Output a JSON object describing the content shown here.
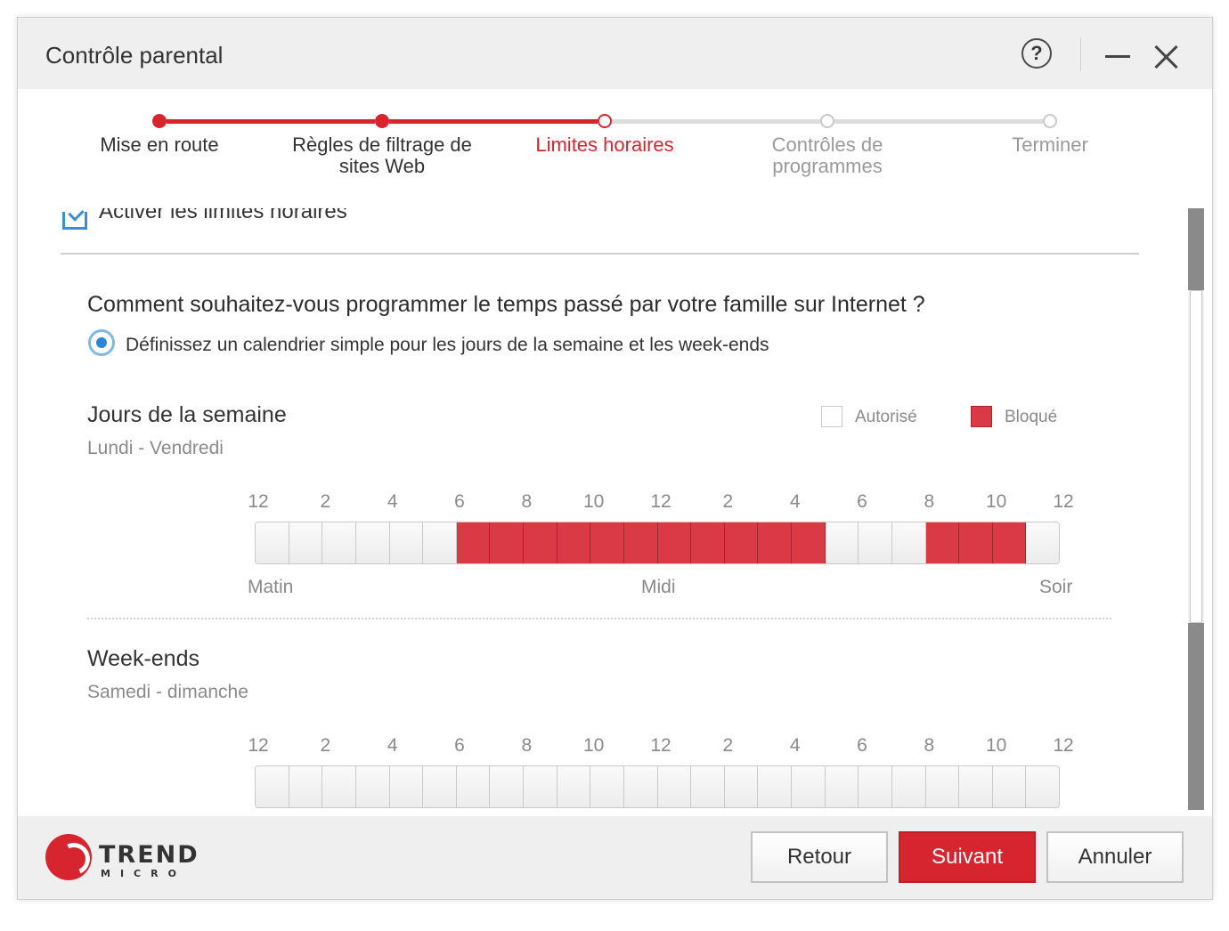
{
  "window": {
    "title": "Contrôle parental"
  },
  "stepper": {
    "steps": [
      {
        "label": "Mise en route",
        "state": "done"
      },
      {
        "label": "Règles de filtrage de sites Web",
        "state": "done"
      },
      {
        "label": "Limites horaires",
        "state": "current"
      },
      {
        "label": "Contrôles de programmes",
        "state": "pending"
      },
      {
        "label": "Terminer",
        "state": "pending"
      }
    ]
  },
  "content": {
    "enable_label": "Activer les limites horaires",
    "question": "Comment souhaitez-vous programmer le temps passé par votre famille sur Internet ?",
    "radio_label": "Définissez un calendrier simple pour les jours de la semaine et les week-ends",
    "legend": {
      "allowed": "Autorisé",
      "blocked": "Bloqué"
    },
    "hour_labels": [
      "12",
      "2",
      "4",
      "6",
      "8",
      "10",
      "12",
      "2",
      "4",
      "6",
      "8",
      "10",
      "12"
    ],
    "captions": {
      "morning": "Matin",
      "noon": "Midi",
      "evening": "Soir"
    },
    "weekdays": {
      "title": "Jours de la semaine",
      "subtitle": "Lundi - Vendredi",
      "blocked_hours": [
        6,
        7,
        8,
        9,
        10,
        11,
        12,
        13,
        14,
        15,
        16,
        20,
        21,
        22
      ]
    },
    "weekends": {
      "title": "Week-ends",
      "subtitle": "Samedi - dimanche",
      "blocked_hours": []
    }
  },
  "footer": {
    "brand_top": "TREND",
    "brand_bottom": "MICRO",
    "back_label": "Retour",
    "next_label": "Suivant",
    "cancel_label": "Annuler"
  },
  "colors": {
    "accent": "#d7252f",
    "blocked": "#d93a45",
    "check": "#3b8ed6",
    "pending": "#d0d0d0"
  }
}
